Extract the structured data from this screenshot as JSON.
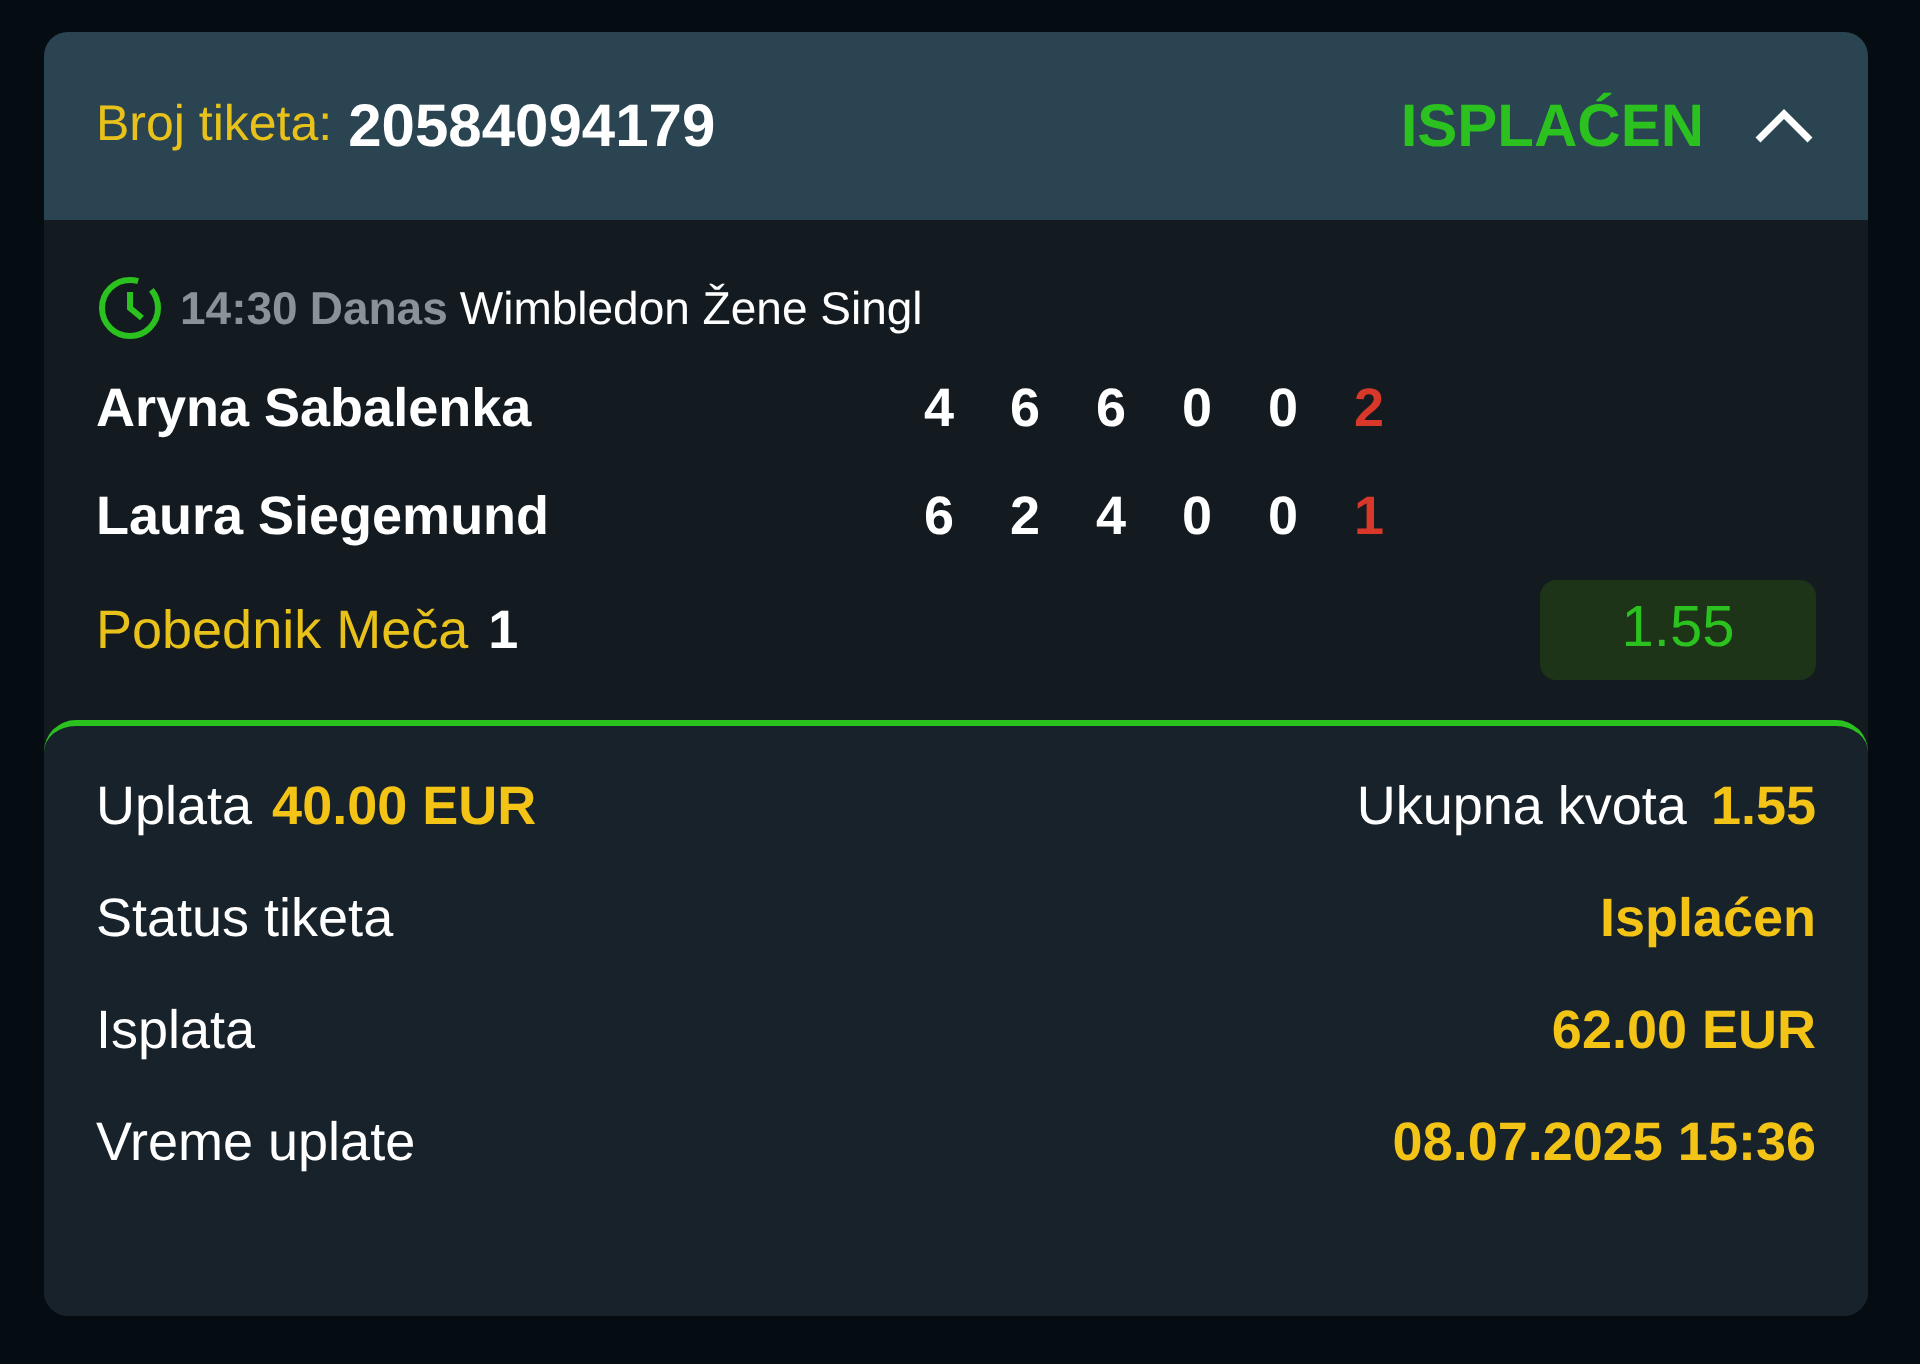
{
  "ticket": {
    "label": "Broj tiketa:",
    "number": "20584094179",
    "status": "ISPLAĆEN",
    "expanded": true
  },
  "match": {
    "time": "14:30",
    "day": "Danas",
    "competition": "Wimbledon Žene Singl",
    "players": [
      {
        "name": "Aryna Sabalenka",
        "scores": [
          "4",
          "6",
          "6",
          "0",
          "0"
        ],
        "sets": "2"
      },
      {
        "name": "Laura Siegemund",
        "scores": [
          "6",
          "2",
          "4",
          "0",
          "0"
        ],
        "sets": "1"
      }
    ],
    "market": "Pobednik Meča",
    "pick": "1",
    "odds": "1.55"
  },
  "summary": {
    "stake_label": "Uplata",
    "stake": "40.00 EUR",
    "total_odds_label": "Ukupna kvota",
    "total_odds": "1.55",
    "rows": [
      {
        "label": "Status tiketa",
        "value": "Isplaćen"
      },
      {
        "label": "Isplata",
        "value": "62.00 EUR"
      },
      {
        "label": "Vreme uplate",
        "value": "08.07.2025 15:36"
      }
    ]
  }
}
